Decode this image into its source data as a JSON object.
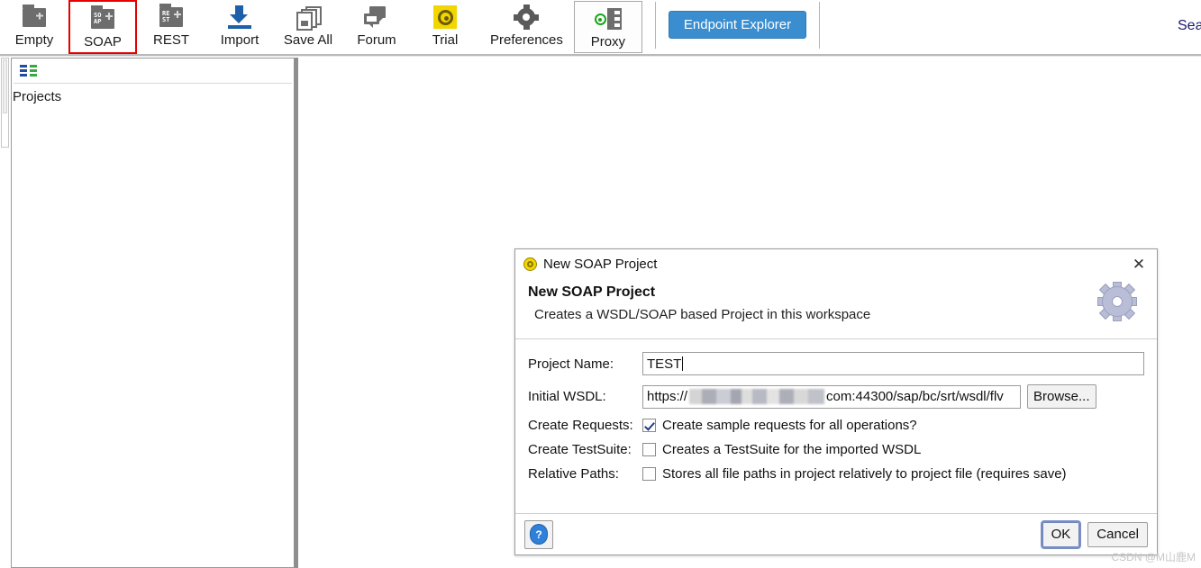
{
  "toolbar": {
    "items": [
      {
        "label": "Empty",
        "icon": "new-empty-project-icon"
      },
      {
        "label": "SOAP",
        "icon": "new-soap-project-icon",
        "highlighted": true
      },
      {
        "label": "REST",
        "icon": "new-rest-project-icon"
      },
      {
        "label": "Import",
        "icon": "import-project-icon"
      },
      {
        "label": "Save All",
        "icon": "save-all-icon"
      },
      {
        "label": "Forum",
        "icon": "forum-icon"
      },
      {
        "label": "Trial",
        "icon": "trial-icon"
      },
      {
        "label": "Preferences",
        "icon": "gear-icon"
      },
      {
        "label": "Proxy",
        "icon": "proxy-server-icon"
      }
    ],
    "soap_icon_line1": "SO",
    "soap_icon_line2": "AP",
    "rest_icon_line1": "RE",
    "rest_icon_line2": "ST",
    "endpoint_explorer_label": "Endpoint Explorer",
    "search_label": "Sea",
    "accent_blue": "#3a8ed0",
    "highlight_red": "#e60000"
  },
  "sidebar": {
    "navigator_icon": "projects-grid-icon",
    "title": "Projects"
  },
  "dialog": {
    "window_title": "New SOAP Project",
    "title_icon": "soapui-logo-icon",
    "close_icon": "close-icon",
    "header_icon": "gear-icon",
    "heading": "New SOAP Project",
    "subheading": "Creates a WSDL/SOAP based Project in this workspace",
    "fields": [
      {
        "label": "Project Name:",
        "value": "TEST",
        "type": "text"
      },
      {
        "label": "Initial WSDL:",
        "value_prefix": "https://",
        "value_redacted": true,
        "value_suffix": "com:44300/sap/bc/srt/wsdl/flv",
        "type": "text",
        "button": "Browse..."
      }
    ],
    "checkboxes": [
      {
        "label": "Create Requests:",
        "text": "Create sample requests for all operations?",
        "checked": true
      },
      {
        "label": "Create TestSuite:",
        "text": "Creates a TestSuite for the imported WSDL",
        "checked": false
      },
      {
        "label": "Relative Paths:",
        "text": "Stores all file paths in project relatively to project file (requires save)",
        "checked": false
      }
    ],
    "help_icon": "help-question-icon",
    "help_glyph": "?",
    "ok_label": "OK",
    "cancel_label": "Cancel"
  },
  "watermark": "CSDN @M山鹿M"
}
